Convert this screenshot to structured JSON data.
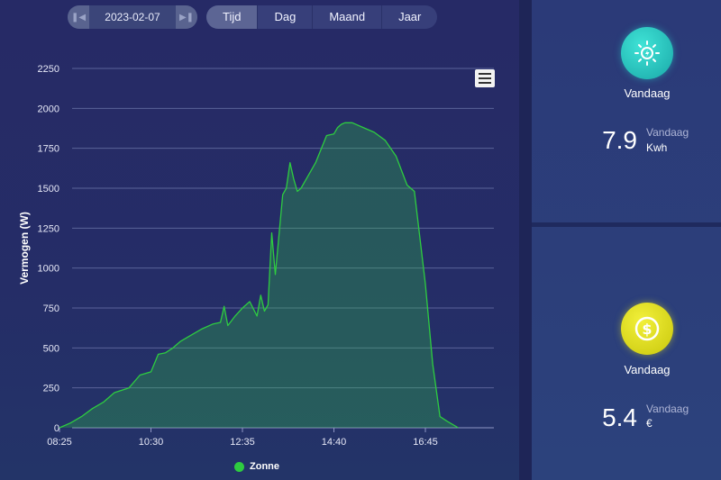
{
  "toolbar": {
    "date": "2023-02-07",
    "tabs": [
      "Tijd",
      "Dag",
      "Maand",
      "Jaar"
    ],
    "active_tab": "Tijd"
  },
  "chart_data": {
    "type": "area",
    "ylabel": "Vermogen (W)",
    "xlabel": "",
    "ylim": [
      0,
      2250
    ],
    "yticks": [
      0,
      250,
      500,
      750,
      1000,
      1250,
      1500,
      1750,
      2000,
      2250
    ],
    "xticks": [
      "08:25",
      "10:30",
      "12:35",
      "14:40",
      "16:45"
    ],
    "grid": true,
    "legend_position": "bottom-center",
    "series": [
      {
        "name": "Zonne",
        "color": "#2ecc40",
        "x": [
          "08:25",
          "08:40",
          "08:55",
          "09:10",
          "09:25",
          "09:40",
          "10:00",
          "10:15",
          "10:30",
          "10:40",
          "10:50",
          "11:00",
          "11:10",
          "11:25",
          "11:40",
          "11:55",
          "12:05",
          "12:10",
          "12:15",
          "12:25",
          "12:35",
          "12:45",
          "12:55",
          "13:00",
          "13:05",
          "13:10",
          "13:15",
          "13:20",
          "13:30",
          "13:35",
          "13:40",
          "13:45",
          "13:50",
          "13:55",
          "14:05",
          "14:15",
          "14:30",
          "14:40",
          "14:45",
          "14:50",
          "14:55",
          "15:05",
          "15:20",
          "15:35",
          "15:50",
          "16:05",
          "16:20",
          "16:30",
          "16:45",
          "16:55",
          "17:05",
          "17:15",
          "17:30"
        ],
        "values": [
          0,
          30,
          70,
          120,
          160,
          220,
          250,
          330,
          350,
          460,
          470,
          500,
          540,
          580,
          620,
          650,
          660,
          760,
          640,
          700,
          750,
          790,
          700,
          830,
          730,
          770,
          1220,
          960,
          1460,
          1500,
          1660,
          1560,
          1480,
          1500,
          1580,
          1660,
          1830,
          1840,
          1880,
          1900,
          1910,
          1910,
          1880,
          1850,
          1800,
          1700,
          1520,
          1480,
          900,
          400,
          70,
          40,
          0
        ]
      }
    ]
  },
  "cards": {
    "energy": {
      "title": "Vandaag",
      "value": "7.9",
      "period": "Vandaag",
      "unit": "Kwh",
      "icon": "solar-panel-icon"
    },
    "money": {
      "title": "Vandaag",
      "value": "5.4",
      "period": "Vandaag",
      "unit": "€",
      "icon": "dollar-coin-icon"
    }
  },
  "colors": {
    "accent_teal": "#2fd0c8",
    "accent_yellow": "#e6e41f",
    "series_green": "#2ecc40"
  }
}
